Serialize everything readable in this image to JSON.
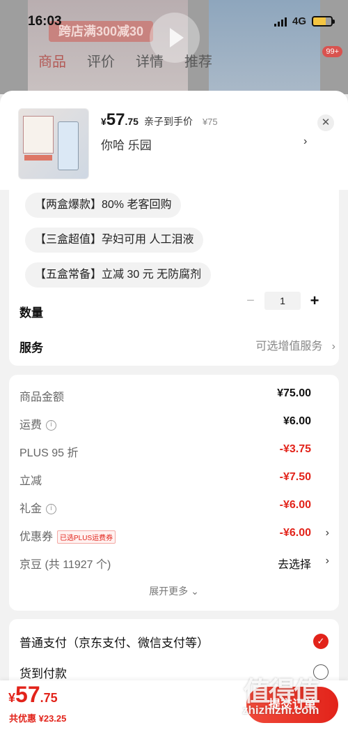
{
  "status_bar": {
    "time": "16:03",
    "network": "4G"
  },
  "background": {
    "banner": "跨店满300减30",
    "tabs": [
      "商品",
      "评价",
      "详情",
      "推荐"
    ],
    "badge": "99+"
  },
  "product": {
    "currency": "¥",
    "price_int": "57",
    "price_dec": ".75",
    "price_label": "亲子到手价",
    "original_price": "¥75",
    "spec": "你哈  乐园"
  },
  "options": [
    "【两盒爆款】80% 老客回购",
    "【三盒超值】孕妇可用 人工泪液",
    "【五盒常备】立减 30 元 无防腐剂"
  ],
  "quantity": {
    "label": "数量",
    "value": "1",
    "minus": "−",
    "plus": "+"
  },
  "service": {
    "label": "服务",
    "hint": "可选增值服务"
  },
  "fees": {
    "goods": {
      "label": "商品金额",
      "value": "¥75.00"
    },
    "shipping": {
      "label": "运费",
      "value": "¥6.00"
    },
    "plus_discount": {
      "label": "PLUS 95 折",
      "value": "-¥3.75"
    },
    "instant": {
      "label": "立减",
      "value": "-¥7.50"
    },
    "gift": {
      "label": "礼金",
      "value": "-¥6.00"
    },
    "coupon": {
      "label": "优惠券",
      "tag": "已选PLUS运费券",
      "value": "-¥6.00"
    },
    "jd_beans": {
      "label": "京豆 (共 11927 个)",
      "value": "去选择"
    },
    "expand": "展开更多 ⌄"
  },
  "payment": {
    "normal": "普通支付（京东支付、微信支付等）",
    "cod": "货到付款"
  },
  "bottom_bar": {
    "currency": "¥",
    "total_int": "57",
    "total_dec": ".75",
    "saved": "共优惠 ¥23.25",
    "submit": "提交订单"
  },
  "watermark": {
    "logo": "值得值",
    "url": "zhizhizhi.com"
  },
  "colors": {
    "accent": "#e2231a",
    "background": "#f2f2f2"
  }
}
